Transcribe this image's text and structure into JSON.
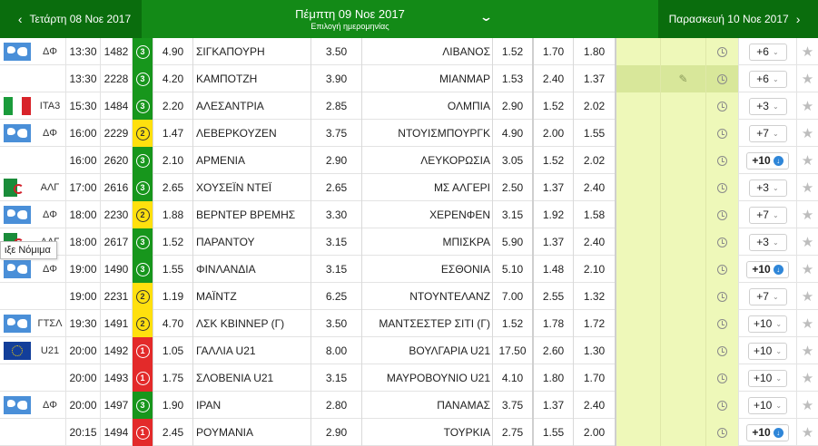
{
  "header": {
    "prev_date": "Τετάρτη 08 Νοε 2017",
    "current_date": "Πέμπτη 09 Νοε 2017",
    "subtitle": "Επιλογή ημερομηνίας",
    "next_date": "Παρασκευή 10 Νοε 2017"
  },
  "tooltip": "ιξε Νόμιμα",
  "rows": [
    {
      "flag": "world",
      "comp": "ΔΦ",
      "time": "13:30",
      "code": "1482",
      "bet": "3",
      "bet_color": "green",
      "o1": "4.90",
      "home": "ΣΙΓΚΑΠΟΥΡΗ",
      "ox": "3.50",
      "away": "ΛΙΒΑΝΟΣ",
      "o2": "1.52",
      "dc1": "1.70",
      "dc2": "1.80",
      "more": "+6",
      "more_kind": "dropdown",
      "highlight": false
    },
    {
      "flag": "",
      "comp": "",
      "time": "13:30",
      "code": "2228",
      "bet": "3",
      "bet_color": "green",
      "o1": "4.20",
      "home": "ΚΑΜΠΟΤΖΗ",
      "ox": "3.90",
      "away": "ΜΙΑΝΜΑΡ",
      "o2": "1.53",
      "dc1": "2.40",
      "dc2": "1.37",
      "more": "+6",
      "more_kind": "dropdown",
      "highlight": true
    },
    {
      "flag": "it",
      "comp": "ΙΤΑ3",
      "time": "15:30",
      "code": "1484",
      "bet": "3",
      "bet_color": "green",
      "o1": "2.20",
      "home": "ΑΛΕΣΑΝΤΡΙΑ",
      "ox": "2.85",
      "away": "ΟΛΜΠΙΑ",
      "o2": "2.90",
      "dc1": "1.52",
      "dc2": "2.02",
      "more": "+3",
      "more_kind": "dropdown",
      "highlight": false
    },
    {
      "flag": "world",
      "comp": "ΔΦ",
      "time": "16:00",
      "code": "2229",
      "bet": "2",
      "bet_color": "yellow",
      "o1": "1.47",
      "home": "ΛΕΒΕΡΚΟΥΖΕΝ",
      "ox": "3.75",
      "away": "ΝΤΟΥΙΣΜΠΟΥΡΓΚ",
      "o2": "4.90",
      "dc1": "2.00",
      "dc2": "1.55",
      "more": "+7",
      "more_kind": "dropdown",
      "highlight": false
    },
    {
      "flag": "",
      "comp": "",
      "time": "16:00",
      "code": "2620",
      "bet": "3",
      "bet_color": "green",
      "o1": "2.10",
      "home": "ΑΡΜΕΝΙΑ",
      "ox": "2.90",
      "away": "ΛΕΥΚΟΡΩΣΙΑ",
      "o2": "3.05",
      "dc1": "1.52",
      "dc2": "2.02",
      "more": "+10",
      "more_kind": "download",
      "highlight": false
    },
    {
      "flag": "dz",
      "comp": "ΑΛΓ",
      "time": "17:00",
      "code": "2616",
      "bet": "3",
      "bet_color": "green",
      "o1": "2.65",
      "home": "ΧΟΥΣΕΪΝ ΝΤΕΪ",
      "ox": "2.65",
      "away": "ΜΣ ΑΛΓΕΡΙ",
      "o2": "2.50",
      "dc1": "1.37",
      "dc2": "2.40",
      "more": "+3",
      "more_kind": "dropdown",
      "highlight": false
    },
    {
      "flag": "world",
      "comp": "ΔΦ",
      "time": "18:00",
      "code": "2230",
      "bet": "2",
      "bet_color": "yellow",
      "o1": "1.88",
      "home": "ΒΕΡΝΤΕΡ ΒΡΕΜΗΣ",
      "ox": "3.30",
      "away": "ΧΕΡΕΝΦΕΝ",
      "o2": "3.15",
      "dc1": "1.92",
      "dc2": "1.58",
      "more": "+7",
      "more_kind": "dropdown",
      "highlight": false
    },
    {
      "flag": "dz",
      "comp": "ΑΛΓ",
      "time": "18:00",
      "code": "2617",
      "bet": "3",
      "bet_color": "green",
      "o1": "1.52",
      "home": "ΠΑΡΑΝΤΟΥ",
      "ox": "3.15",
      "away": "ΜΠΙΣΚΡΑ",
      "o2": "5.90",
      "dc1": "1.37",
      "dc2": "2.40",
      "more": "+3",
      "more_kind": "dropdown",
      "highlight": false
    },
    {
      "flag": "world",
      "comp": "ΔΦ",
      "time": "19:00",
      "code": "1490",
      "bet": "3",
      "bet_color": "green",
      "o1": "1.55",
      "home": "ΦΙΝΛΑΝΔΙΑ",
      "ox": "3.15",
      "away": "ΕΣΘΟΝΙΑ",
      "o2": "5.10",
      "dc1": "1.48",
      "dc2": "2.10",
      "more": "+10",
      "more_kind": "download",
      "highlight": false
    },
    {
      "flag": "",
      "comp": "",
      "time": "19:00",
      "code": "2231",
      "bet": "2",
      "bet_color": "yellow",
      "o1": "1.19",
      "home": "ΜΑΪΝΤΖ",
      "ox": "6.25",
      "away": "ΝΤΟΥΝΤΕΛΑΝΖ",
      "o2": "7.00",
      "dc1": "2.55",
      "dc2": "1.32",
      "more": "+7",
      "more_kind": "dropdown",
      "highlight": false
    },
    {
      "flag": "world",
      "comp": "ΓΤΣΛ",
      "time": "19:30",
      "code": "1491",
      "bet": "2",
      "bet_color": "yellow",
      "o1": "4.70",
      "home": "ΛΣΚ ΚΒΙΝΝΕΡ (Γ)",
      "ox": "3.50",
      "away": "ΜΑΝΤΣΕΣΤΕΡ ΣΙΤΙ (Γ)",
      "o2": "1.52",
      "dc1": "1.78",
      "dc2": "1.72",
      "more": "+10",
      "more_kind": "dropdown",
      "highlight": false
    },
    {
      "flag": "eu",
      "comp": "U21",
      "time": "20:00",
      "code": "1492",
      "bet": "1",
      "bet_color": "red",
      "o1": "1.05",
      "home": "ΓΑΛΛΙΑ U21",
      "ox": "8.00",
      "away": "ΒΟΥΛΓΑΡΙΑ U21",
      "o2": "17.50",
      "dc1": "2.60",
      "dc2": "1.30",
      "more": "+10",
      "more_kind": "dropdown",
      "highlight": false
    },
    {
      "flag": "",
      "comp": "",
      "time": "20:00",
      "code": "1493",
      "bet": "1",
      "bet_color": "red",
      "o1": "1.75",
      "home": "ΣΛΟΒΕΝΙΑ U21",
      "ox": "3.15",
      "away": "ΜΑΥΡΟΒΟΥΝΙΟ U21",
      "o2": "4.10",
      "dc1": "1.80",
      "dc2": "1.70",
      "more": "+10",
      "more_kind": "dropdown",
      "highlight": false
    },
    {
      "flag": "world",
      "comp": "ΔΦ",
      "time": "20:00",
      "code": "1497",
      "bet": "3",
      "bet_color": "green",
      "o1": "1.90",
      "home": "ΙΡΑΝ",
      "ox": "2.80",
      "away": "ΠΑΝΑΜΑΣ",
      "o2": "3.75",
      "dc1": "1.37",
      "dc2": "2.40",
      "more": "+10",
      "more_kind": "dropdown",
      "highlight": false
    },
    {
      "flag": "",
      "comp": "",
      "time": "20:15",
      "code": "1494",
      "bet": "1",
      "bet_color": "red",
      "o1": "2.45",
      "home": "ΡΟΥΜΑΝΙΑ",
      "ox": "2.90",
      "away": "ΤΟΥΡΚΙΑ",
      "o2": "2.75",
      "dc1": "1.55",
      "dc2": "2.00",
      "more": "+10",
      "more_kind": "download",
      "highlight": false
    }
  ]
}
